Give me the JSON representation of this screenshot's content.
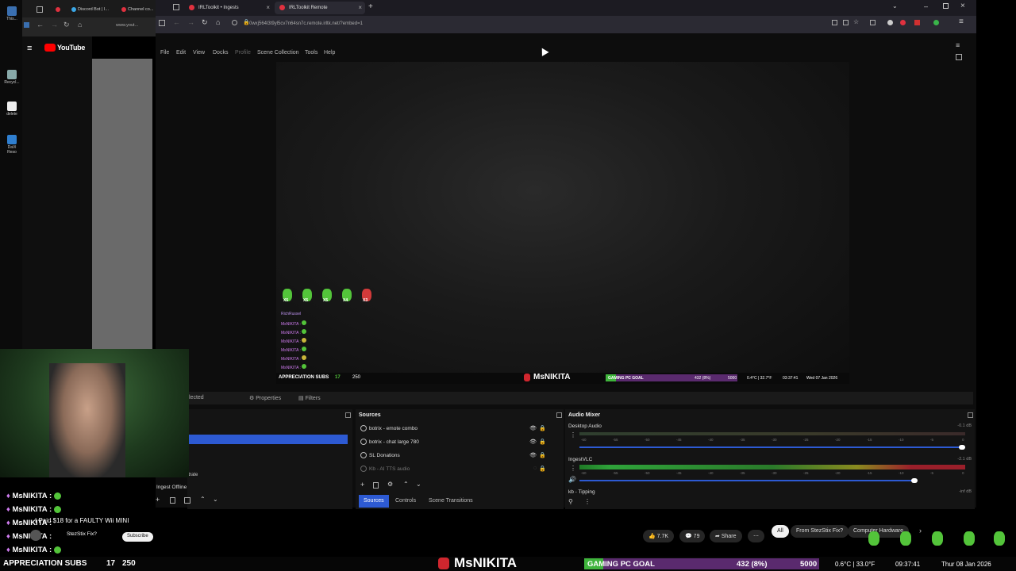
{
  "desktop": {
    "icons": [
      "This...",
      "Recycl...",
      "delete",
      "DaVi Reso"
    ]
  },
  "youtube_window": {
    "tabs": [
      "Discord Bot | I...",
      "Channel co..."
    ],
    "address_text": "www.yout...",
    "logo_text": "YouTube"
  },
  "browser": {
    "tabs": [
      {
        "label": "IRLToolkit • Ingests"
      },
      {
        "label": "IRLToolkit Remote"
      }
    ],
    "url": "0wxj564l3t9yl5cv7n64sn7c.remote.irltk.net/?embed=1"
  },
  "obs": {
    "menu": [
      "File",
      "Edit",
      "View",
      "Docks",
      "Profile",
      "Scene Collection",
      "Tools",
      "Help"
    ],
    "preview_overlay": {
      "bot_user": "RichRussel",
      "chat_user": "MsNIKITA :",
      "emote_counts": [
        "X5",
        "X5",
        "X5",
        "X4",
        "X3"
      ],
      "appreciation_label": "APPRECIATION SUBS",
      "appreciation_count": "17",
      "appreciation_goal": "250",
      "brand": "MsNIKITA",
      "goal_label": "GAMING PC GOAL",
      "goal_value": "432 (8%)",
      "goal_target": "5000",
      "weather": "0.4°C | 32.7°F",
      "clock": "03:37:41",
      "date": "Wed 07 Jan 2026"
    },
    "tabs_bar": {
      "selected_text": "lected",
      "properties": "Properties",
      "filters": "Filters"
    },
    "scenes": {
      "partial_label": "itrate",
      "status": "Ingest Offline"
    },
    "sources": {
      "title": "Sources",
      "items": [
        {
          "label": "botrix - emote combo"
        },
        {
          "label": "botrix - chat large 780"
        },
        {
          "label": "SL Donations"
        },
        {
          "label": "Kb - AI TTS audio"
        }
      ],
      "tabs": [
        "Sources",
        "Controls",
        "Scene Transitions"
      ]
    },
    "mixer": {
      "title": "Audio Mixer",
      "channels": [
        {
          "name": "Desktop Audio",
          "db": "-0.1 dB",
          "volume": 0.99
        },
        {
          "name": "IngestVLC",
          "db": "-2.1 dB",
          "volume": 0.87
        },
        {
          "name": "kb - Tipping",
          "db": "-inf dB",
          "volume": 0
        }
      ],
      "ticks": [
        "-60",
        "-55",
        "-50",
        "-45",
        "-40",
        "-35",
        "-30",
        "-25",
        "-20",
        "-15",
        "-10",
        "-5",
        "0"
      ]
    }
  },
  "stream_chat": [
    {
      "user": "MsNIKITA :"
    },
    {
      "user": "MsNIKITA :"
    },
    {
      "user": "MsNIKITA :",
      "text": "I Paid $18 for a FAULTY Wii MINI"
    },
    {
      "user": "MsNIKITA :",
      "text": "StezStix Fix?"
    },
    {
      "user": "MsNIKITA :"
    }
  ],
  "youtube_toolbar": {
    "subscribe": "Subscribe",
    "likes": "7.7K",
    "comments": "79",
    "share": "Share",
    "chips": [
      "All",
      "From StezStix Fix?",
      "Computer Hardware"
    ]
  },
  "stream_bar": {
    "appreciation_label": "APPRECIATION SUBS",
    "appreciation_count": "17",
    "appreciation_goal": "250",
    "brand": "MsNIKITA",
    "goal_label": "GAMING PC GOAL",
    "goal_value": "432 (8%)",
    "goal_target": "5000",
    "weather": "0.6°C | 33.0°F",
    "clock": "09:37:41",
    "date": "Thur 08 Jan 2026"
  },
  "colors": {
    "obs_selection": "#2d5ad3",
    "emote_green": "#53c43a",
    "goal_green": "#3fb43c",
    "brand_red": "#d0262e"
  }
}
